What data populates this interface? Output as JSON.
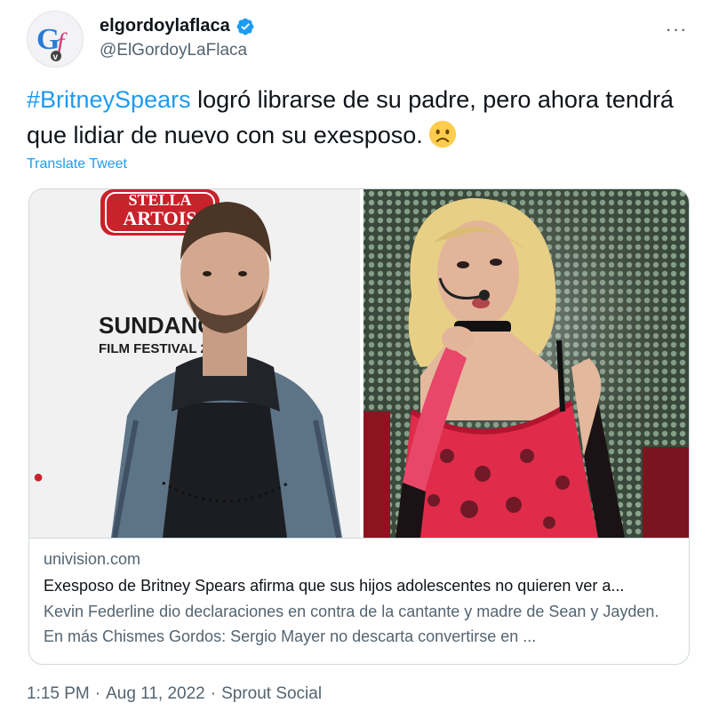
{
  "tweet": {
    "author": {
      "display_name": "elgordoylaflaca",
      "handle": "@ElGordoyLaFlaca",
      "verified_icon": "verified-badge-icon",
      "avatar_letters": "GfV"
    },
    "more_label": "···",
    "text": {
      "hashtag": "#BritneySpears",
      "body": " logró librarse de su padre, pero ahora tendrá que lidiar de nuevo con su exesposo.",
      "emoji": "slightly-frowning-face-emoji"
    },
    "translate_label": "Translate Tweet",
    "card": {
      "image_signs": {
        "stella": "STELLA",
        "artois": "ARTOIS",
        "sundance": "SUNDANCE",
        "festival": "FILM FESTIVAL 2"
      },
      "domain": "univision.com",
      "title": "Exesposo de Britney Spears afirma que sus hijos adolescentes no quieren ver a...",
      "description": "Kevin Federline dio declaraciones en contra de la cantante y madre de Sean y Jayden. En más Chismes Gordos: Sergio Mayer no descarta convertirse en ..."
    },
    "footer": {
      "time": "1:15 PM",
      "separator1": "·",
      "date": "Aug 11, 2022",
      "separator2": "·",
      "source": "Sprout Social"
    },
    "colors": {
      "accent": "#1d9bf0",
      "text": "#0f1419",
      "secondary": "#536471",
      "border": "#cfd9de"
    }
  }
}
